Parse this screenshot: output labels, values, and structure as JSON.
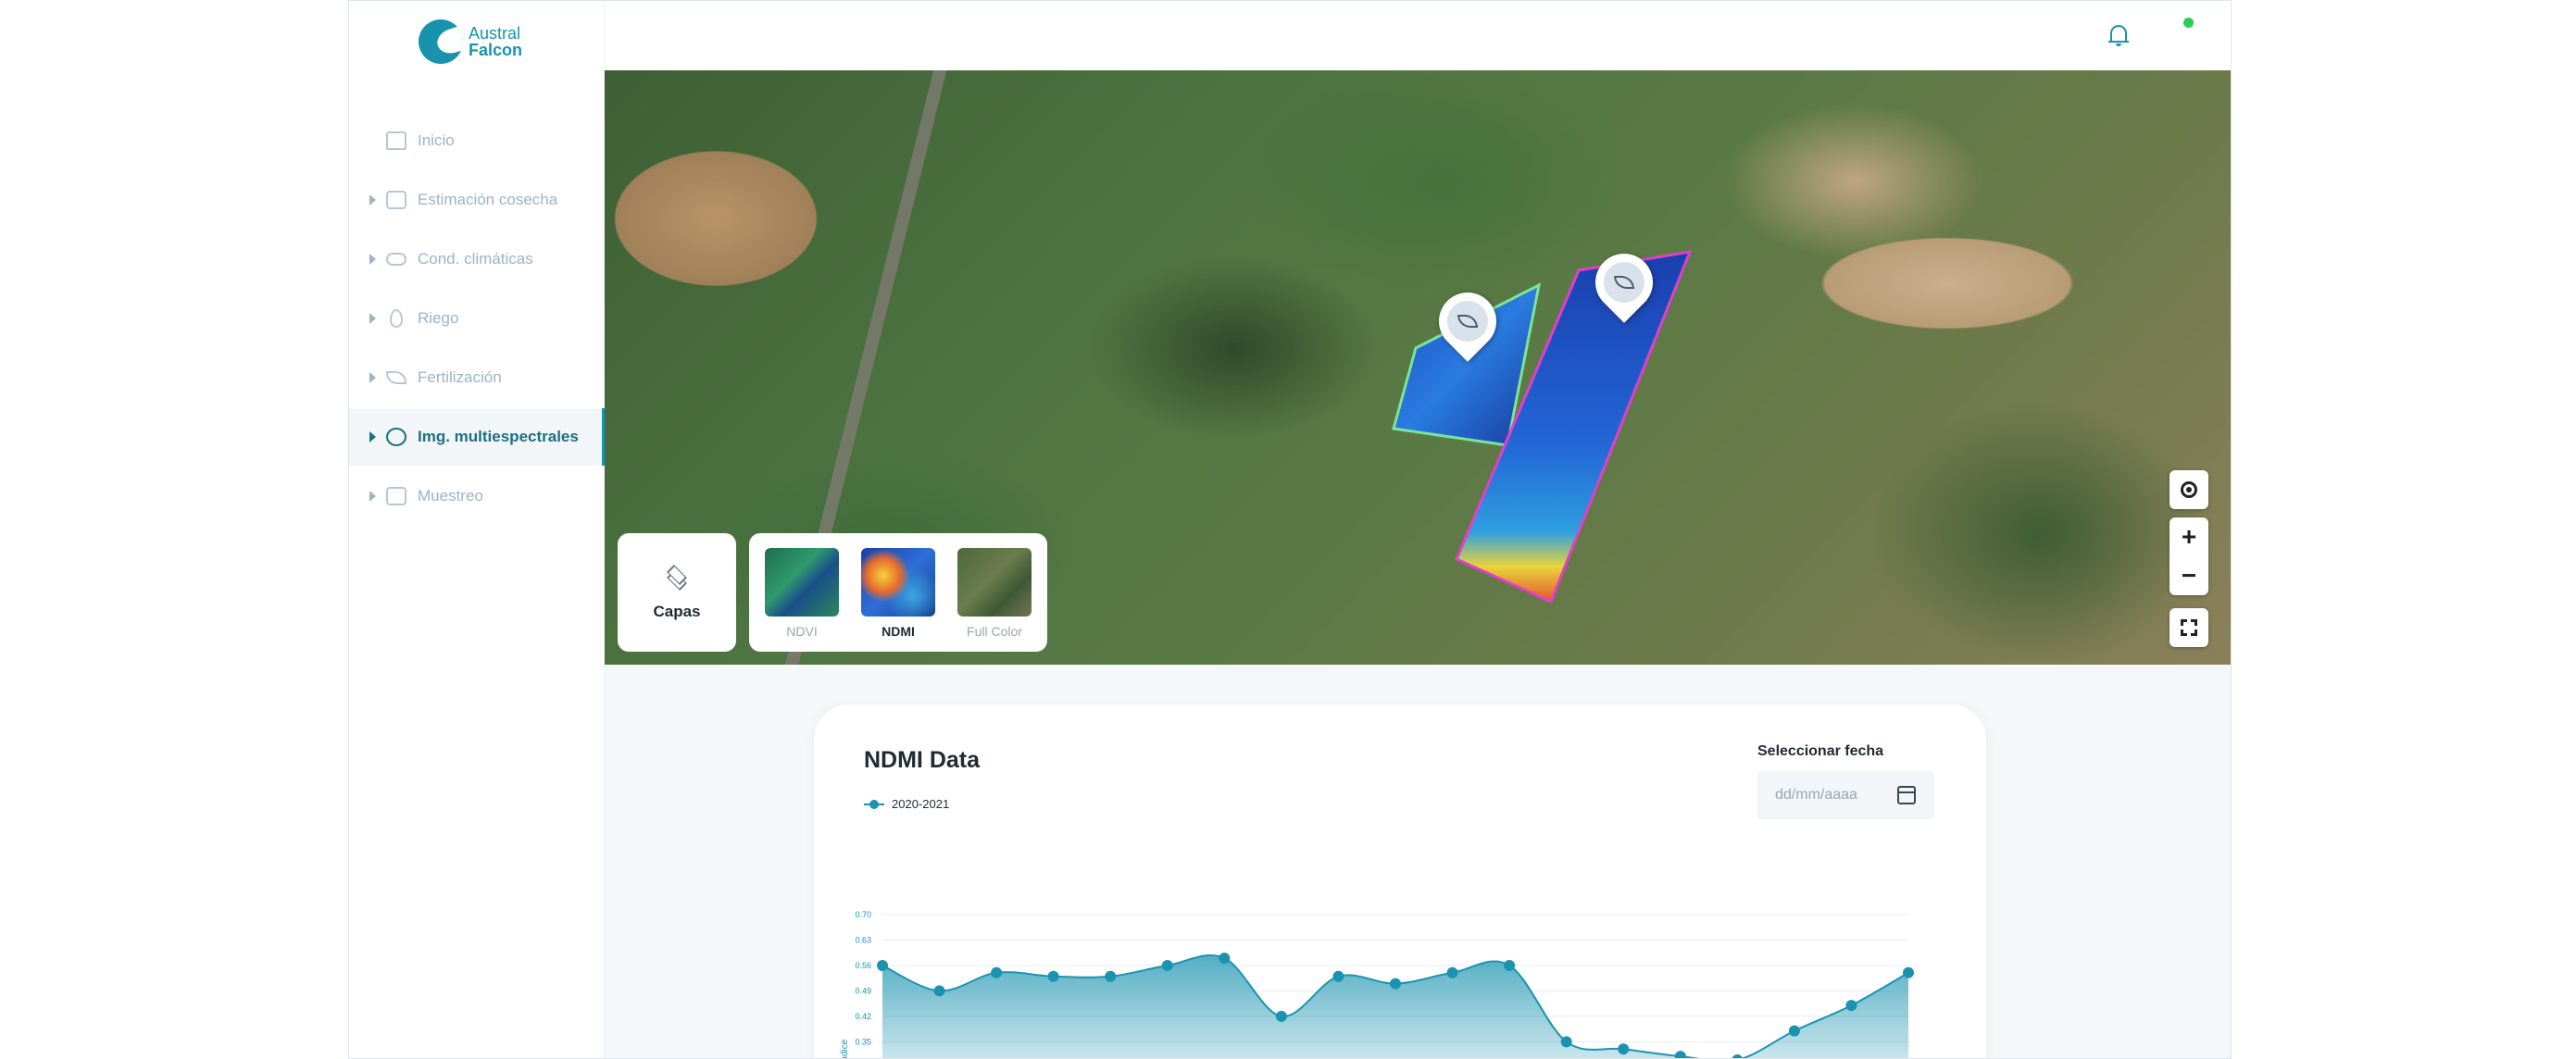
{
  "brand": {
    "line1": "Austral",
    "line2": "Falcon"
  },
  "sidebar": {
    "items": [
      {
        "label": "Inicio",
        "icon": "home-icon",
        "expandable": false,
        "active": false
      },
      {
        "label": "Estimación cosecha",
        "icon": "harvest-chart-icon",
        "expandable": true,
        "active": false
      },
      {
        "label": "Cond. climáticas",
        "icon": "cloud-icon",
        "expandable": true,
        "active": false
      },
      {
        "label": "Riego",
        "icon": "water-drop-icon",
        "expandable": true,
        "active": false
      },
      {
        "label": "Fertilización",
        "icon": "leaf-icon",
        "expandable": true,
        "active": false
      },
      {
        "label": "Img. multiespectrales",
        "icon": "satellite-icon",
        "expandable": true,
        "active": true
      },
      {
        "label": "Muestreo",
        "icon": "sample-image-icon",
        "expandable": true,
        "active": false
      }
    ]
  },
  "topbar": {
    "notifications_icon": "bell-icon",
    "status": "online",
    "status_color": "#2ecc52"
  },
  "map": {
    "capas_label": "Capas",
    "layers": [
      {
        "label": "NDVI",
        "selected": false
      },
      {
        "label": "NDMI",
        "selected": true
      },
      {
        "label": "Full Color",
        "selected": false
      }
    ],
    "controls": [
      "locate-icon",
      "zoom-in-icon",
      "zoom-out-icon",
      "fullscreen-icon"
    ],
    "zoom_in_symbol": "+",
    "zoom_out_symbol": "−",
    "field_outline_colors": [
      "#7be39a",
      "#e040c8"
    ]
  },
  "chart_card": {
    "title": "NDMI Data",
    "date_label": "Seleccionar fecha",
    "date_placeholder": "dd/mm/aaaa"
  },
  "chart_data": {
    "type": "area",
    "title": "NDMI Data",
    "ylabel": "Índice",
    "xlabel": "",
    "y_ticks": [
      "0.70",
      "0.63",
      "0.56",
      "0.49",
      "0.42",
      "0.35"
    ],
    "ylim": [
      0.3,
      0.7
    ],
    "legend_position": "top-left",
    "grid": true,
    "color": "#1b93b0",
    "series": [
      {
        "name": "2020-2021",
        "values": [
          0.56,
          0.49,
          0.54,
          0.53,
          0.53,
          0.56,
          0.58,
          0.42,
          0.53,
          0.51,
          0.54,
          0.56,
          0.35,
          0.33,
          0.31,
          0.3,
          0.38,
          0.45,
          0.54
        ]
      }
    ]
  }
}
